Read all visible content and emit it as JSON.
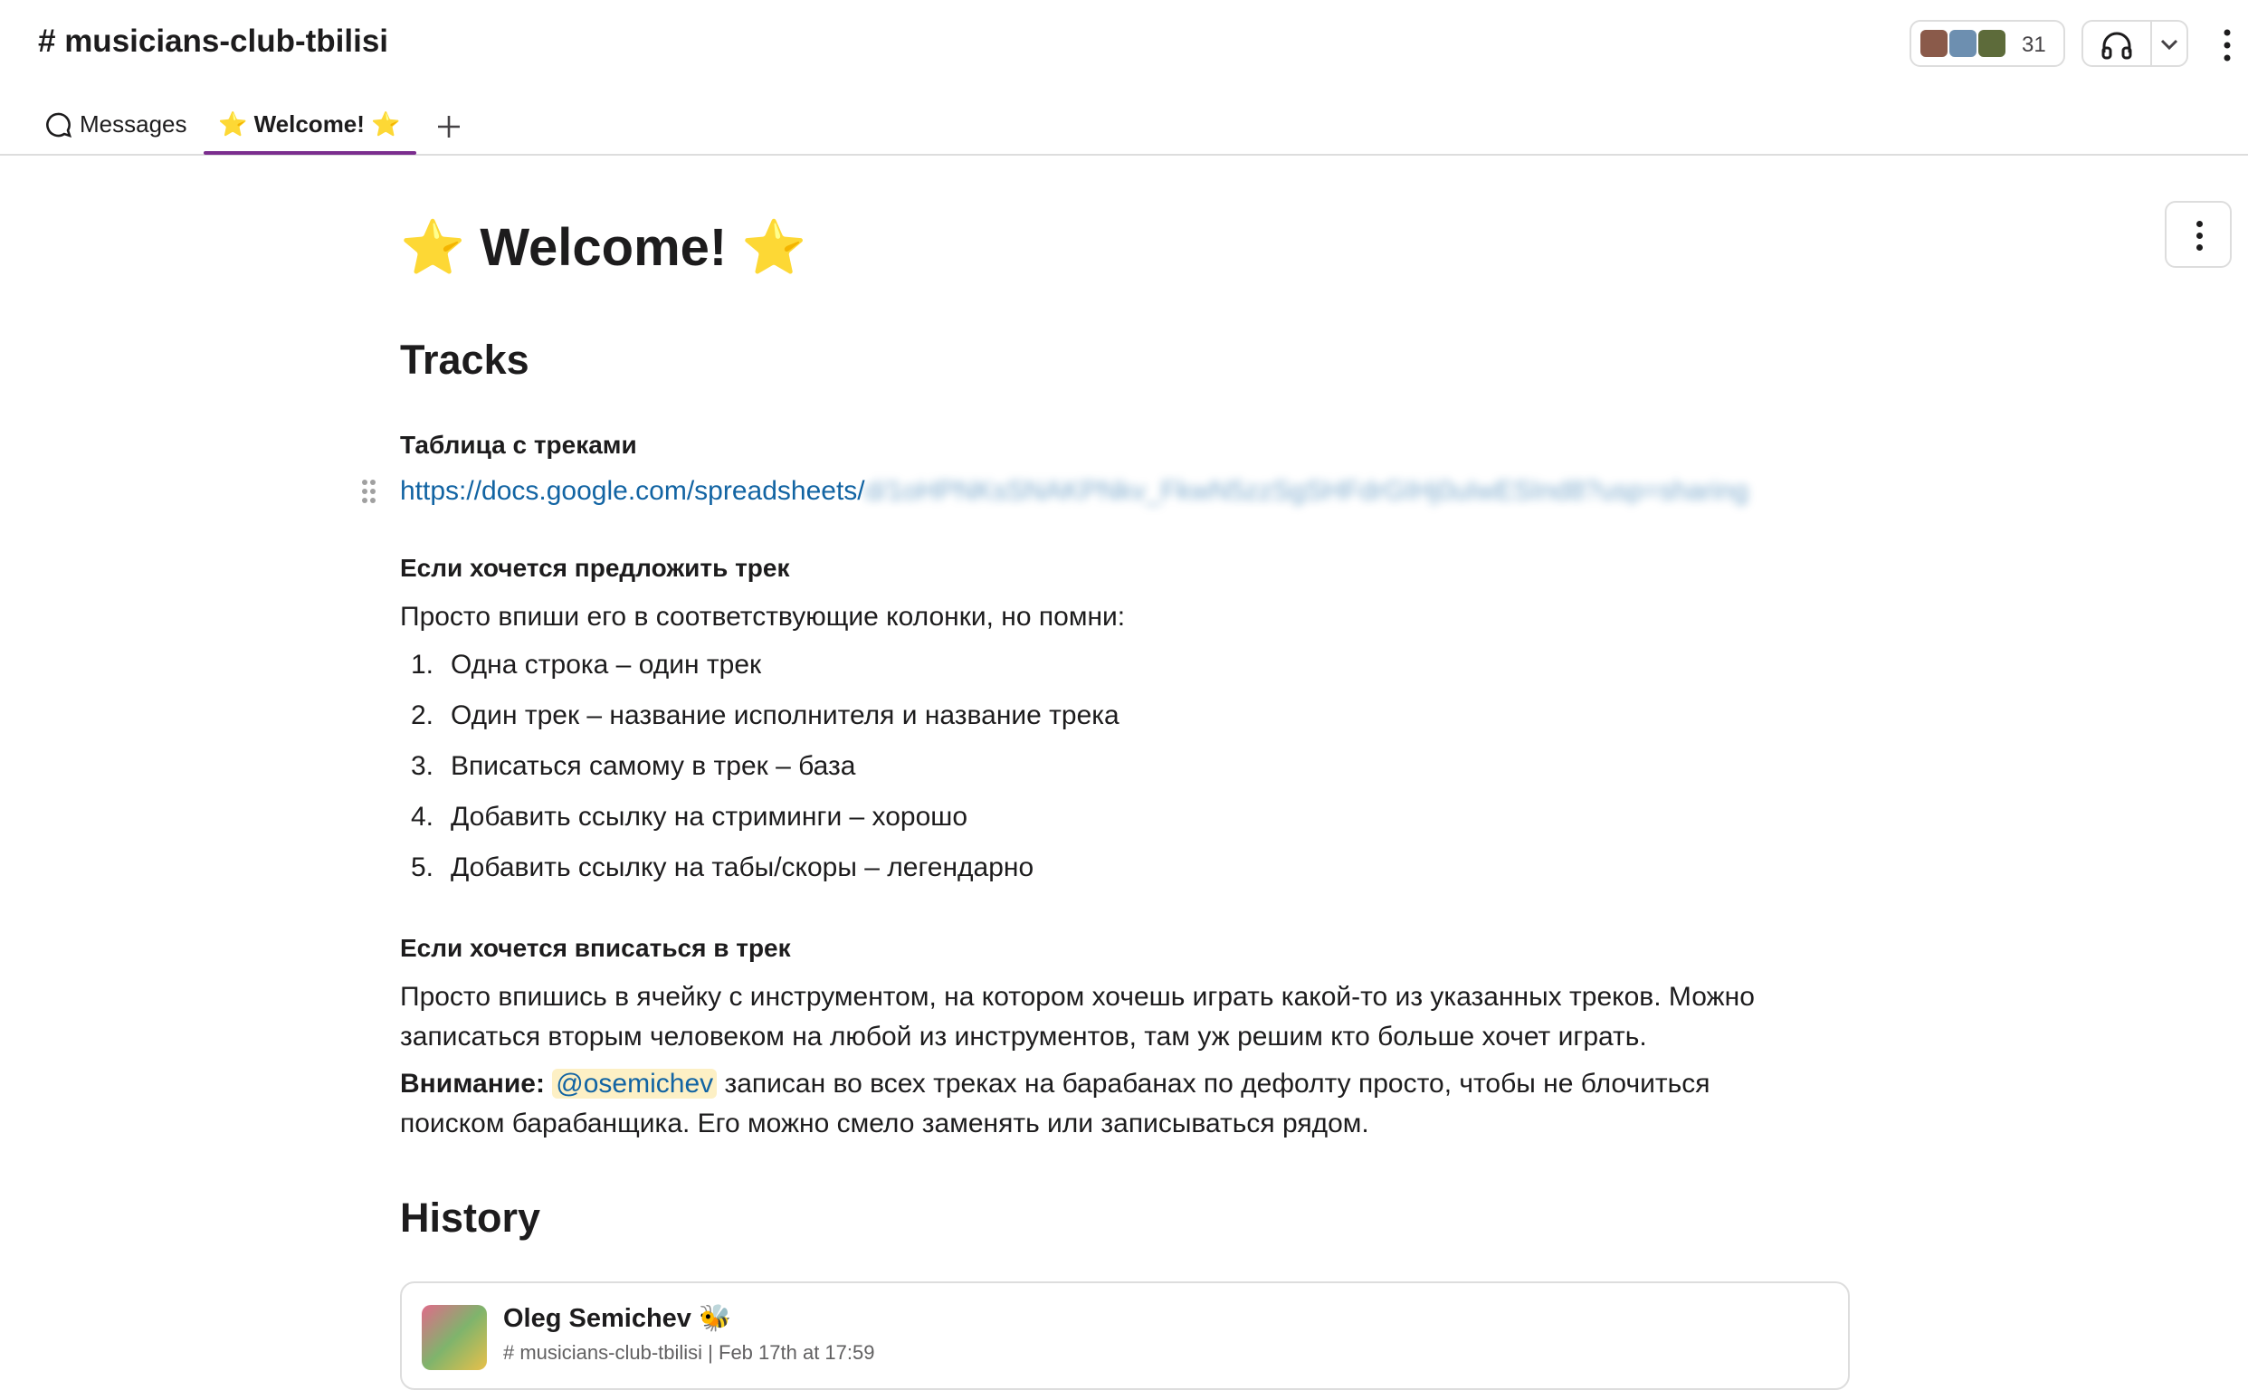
{
  "header": {
    "channel_title": "# musicians-club-tbilisi",
    "member_count": "31",
    "tabs": [
      {
        "label": "Messages",
        "icon": "chat-bubble-icon"
      },
      {
        "label": "⭐ Welcome! ⭐",
        "icon": "star-icon",
        "active": true
      }
    ]
  },
  "doc": {
    "title": "⭐ Welcome! ⭐",
    "sections": {
      "tracks": {
        "heading": "Tracks",
        "table_label": "Таблица с треками",
        "link_visible": "https://docs.google.com/spreadsheets/",
        "link_blurred": "d/1oHPNKsSNAKPNkv_FkwN5zzSgSHFdrGIHj0uIwESInd8?usp=sharing",
        "suggest_heading": "Если хочется предложить трек",
        "suggest_intro": "Просто впиши его в соответствующие колонки, но помни:",
        "rules": [
          "Одна строка – один трек",
          "Один трек – название исполнителя и название трека",
          "Вписаться самому в трек – база",
          "Добавить ссылку на стриминги – хорошо",
          "Добавить ссылку на табы/скоры – легендарно"
        ],
        "join_heading": "Если хочется вписаться в трек",
        "join_text": "Просто впишись в ячейку с инструментом, на котором хочешь играть какой-то из указанных треков. Можно записаться вторым человеком на любой из инструментов, там уж решим кто больше хочет играть.",
        "attention_label": "Внимание:",
        "attention_mention": "@osemichev",
        "attention_text": " записан во всех треках на барабанах по дефолту просто, чтобы не блочиться поиском барабанщика. Его можно смело заменять или записываться рядом."
      },
      "history": {
        "heading": "History"
      }
    }
  },
  "message_card": {
    "author": "Oleg Semichev 🐝",
    "meta": "# musicians-club-tbilisi | Feb 17th at 17:59"
  },
  "colors": {
    "accent": "#7b2d8e",
    "link": "#1264a3",
    "mention_bg": "#fdf0c5",
    "border": "#dddddd"
  }
}
